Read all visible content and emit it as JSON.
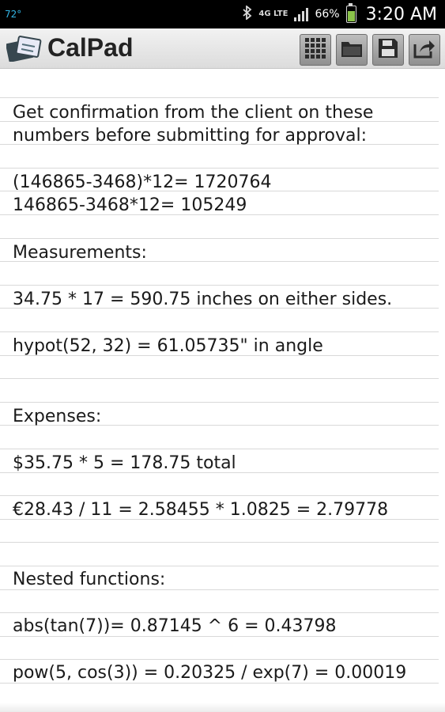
{
  "status_bar": {
    "temperature": "72°",
    "network": "4G LTE",
    "battery_percent": "66%",
    "battery_level": 0.66,
    "time": "3:20 AM"
  },
  "app_bar": {
    "title": "CalPad",
    "actions": [
      "calculator-keypad",
      "open-folder",
      "save",
      "share"
    ]
  },
  "note": {
    "lines": [
      "Get confirmation from the client on these",
      "numbers before submitting for approval:",
      "(146865-3468)*12= 1720764",
      "146865-3468*12= 105249",
      "Measurements:",
      "34.75 * 17 = 590.75 inches on either sides.",
      "hypot(52, 32) = 61.05735\" in angle",
      "Expenses:",
      "$35.75 * 5 = 178.75 total",
      "€28.43 / 11 = 2.58455 * 1.0825 = 2.79778",
      "Nested functions:",
      "abs(tan(7))= 0.87145 ^ 6 = 0.43798",
      "pow(5, cos(3)) = 0.20325 / exp(7) = 0.00019"
    ]
  },
  "colors": {
    "status_bar_bg": "#000000",
    "temperature_text": "#33b5e5",
    "battery_fill": "#8bc34a",
    "app_bar_bg": "#e6e6e6",
    "ruled_line": "#d9d9d9"
  }
}
